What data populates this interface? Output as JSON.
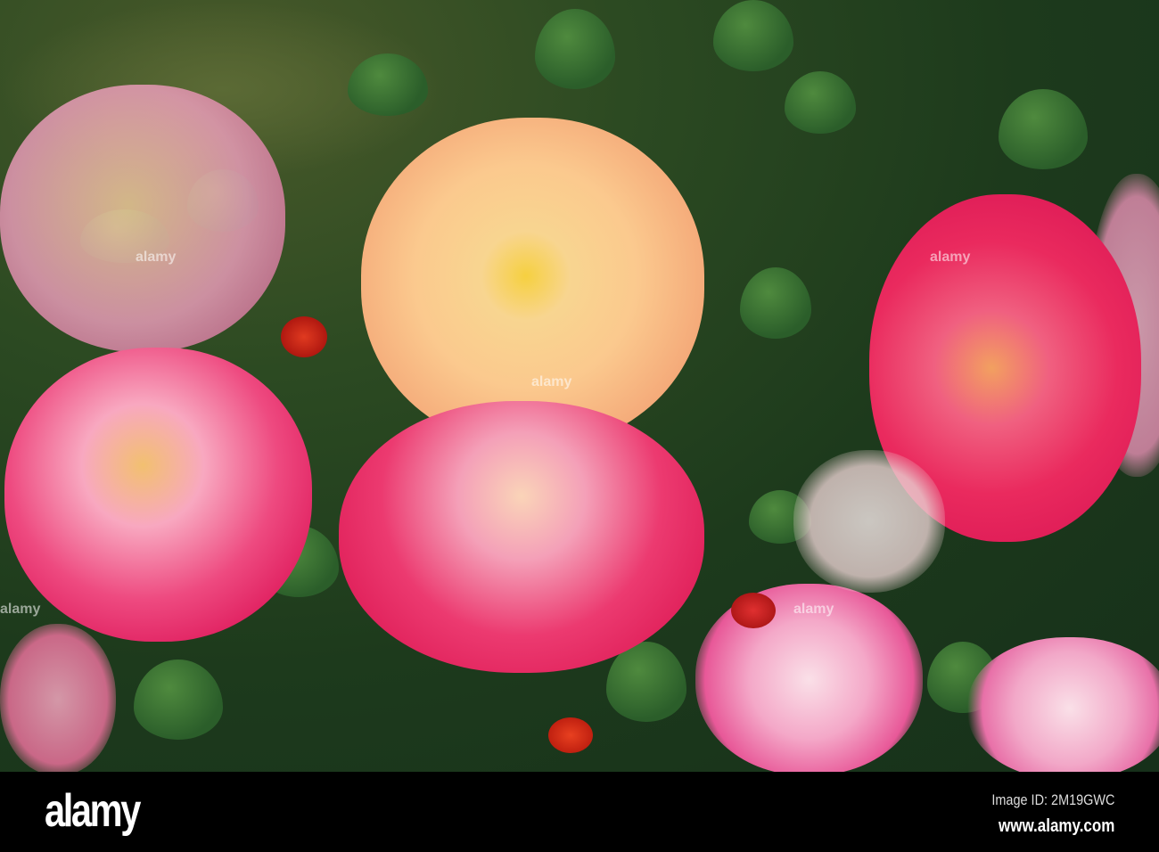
{
  "footer": {
    "logo": "alamy",
    "image_id": "Image ID: 2M19GWC",
    "website": "www.alamy.com"
  },
  "watermark": "alamy",
  "colors": {
    "foliage": "#2b5e2a",
    "peach_rose": "#f7c27a",
    "pink_rose": "#e8306a",
    "light_pink_rose": "#f2a0c4"
  }
}
